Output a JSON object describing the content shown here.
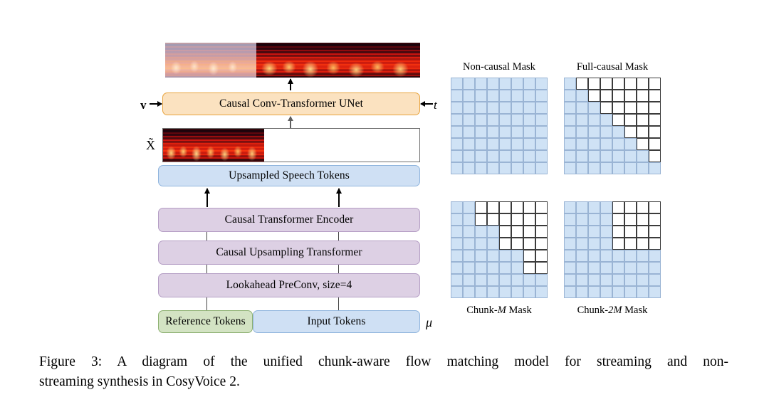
{
  "figure": {
    "caption_line1": "Figure 3:  A diagram of the unified chunk-aware flow matching model for streaming and non-",
    "caption_line2": "streaming synthesis in CosyVoice 2."
  },
  "pipeline": {
    "unet_label": "Causal Conv-Transformer UNet",
    "upsampled_label": "Upsampled Speech Tokens",
    "encoder_label": "Causal Transformer Encoder",
    "upsampling_label": "Causal Upsampling Transformer",
    "preconv_label": "Lookahead PreConv, size=4",
    "reference_tokens_label": "Reference Tokens",
    "input_tokens_label": "Input Tokens",
    "velocity_symbol": "v",
    "time_symbol": "t",
    "xtilde_symbol": "X̃",
    "mu_symbol": "μ"
  },
  "masks": [
    {
      "id": "non-causal",
      "title": "Non-causal Mask",
      "title_position": "top",
      "size": 8,
      "rows": [
        [
          1,
          1,
          1,
          1,
          1,
          1,
          1,
          1
        ],
        [
          1,
          1,
          1,
          1,
          1,
          1,
          1,
          1
        ],
        [
          1,
          1,
          1,
          1,
          1,
          1,
          1,
          1
        ],
        [
          1,
          1,
          1,
          1,
          1,
          1,
          1,
          1
        ],
        [
          1,
          1,
          1,
          1,
          1,
          1,
          1,
          1
        ],
        [
          1,
          1,
          1,
          1,
          1,
          1,
          1,
          1
        ],
        [
          1,
          1,
          1,
          1,
          1,
          1,
          1,
          1
        ],
        [
          1,
          1,
          1,
          1,
          1,
          1,
          1,
          1
        ]
      ]
    },
    {
      "id": "full-causal",
      "title": "Full-causal Mask",
      "title_position": "top",
      "size": 8,
      "rows": [
        [
          1,
          0,
          0,
          0,
          0,
          0,
          0,
          0
        ],
        [
          1,
          1,
          0,
          0,
          0,
          0,
          0,
          0
        ],
        [
          1,
          1,
          1,
          0,
          0,
          0,
          0,
          0
        ],
        [
          1,
          1,
          1,
          1,
          0,
          0,
          0,
          0
        ],
        [
          1,
          1,
          1,
          1,
          1,
          0,
          0,
          0
        ],
        [
          1,
          1,
          1,
          1,
          1,
          1,
          0,
          0
        ],
        [
          1,
          1,
          1,
          1,
          1,
          1,
          1,
          0
        ],
        [
          1,
          1,
          1,
          1,
          1,
          1,
          1,
          1
        ]
      ]
    },
    {
      "id": "chunk-m",
      "title": "Chunk-M Mask",
      "title_html": "Chunk-<i>M</i> Mask",
      "title_position": "bottom",
      "size": 8,
      "chunk": 2,
      "rows": [
        [
          1,
          1,
          0,
          0,
          0,
          0,
          0,
          0
        ],
        [
          1,
          1,
          0,
          0,
          0,
          0,
          0,
          0
        ],
        [
          1,
          1,
          1,
          1,
          0,
          0,
          0,
          0
        ],
        [
          1,
          1,
          1,
          1,
          0,
          0,
          0,
          0
        ],
        [
          1,
          1,
          1,
          1,
          1,
          1,
          0,
          0
        ],
        [
          1,
          1,
          1,
          1,
          1,
          1,
          0,
          0
        ],
        [
          1,
          1,
          1,
          1,
          1,
          1,
          1,
          1
        ],
        [
          1,
          1,
          1,
          1,
          1,
          1,
          1,
          1
        ]
      ]
    },
    {
      "id": "chunk-2m",
      "title": "Chunk-2M Mask",
      "title_html": "Chunk-<i>2M</i> Mask",
      "title_position": "bottom",
      "size": 8,
      "chunk": 4,
      "rows": [
        [
          1,
          1,
          1,
          1,
          0,
          0,
          0,
          0
        ],
        [
          1,
          1,
          1,
          1,
          0,
          0,
          0,
          0
        ],
        [
          1,
          1,
          1,
          1,
          0,
          0,
          0,
          0
        ],
        [
          1,
          1,
          1,
          1,
          0,
          0,
          0,
          0
        ],
        [
          1,
          1,
          1,
          1,
          1,
          1,
          1,
          1
        ],
        [
          1,
          1,
          1,
          1,
          1,
          1,
          1,
          1
        ],
        [
          1,
          1,
          1,
          1,
          1,
          1,
          1,
          1
        ],
        [
          1,
          1,
          1,
          1,
          1,
          1,
          1,
          1
        ]
      ]
    }
  ],
  "colors": {
    "mask_on_fill": "#cfe2f5",
    "mask_on_border": "#9ab4d4",
    "mask_off_border": "#3b3b3b",
    "orange_fill": "#fbe2c0",
    "orange_border": "#e8a33d",
    "blue_fill": "#cfe0f4",
    "blue_border": "#8fb4dd",
    "purple_fill": "#ddd0e4",
    "purple_border": "#b49dc4",
    "green_fill": "#d3e3c3",
    "green_border": "#8cb070"
  },
  "spectrograms": {
    "output_left_segment": "faded-mel-spectrogram",
    "output_right_segment": "bright-mel-spectrogram",
    "xtilde_segment": "reference-mel-spectrogram"
  }
}
